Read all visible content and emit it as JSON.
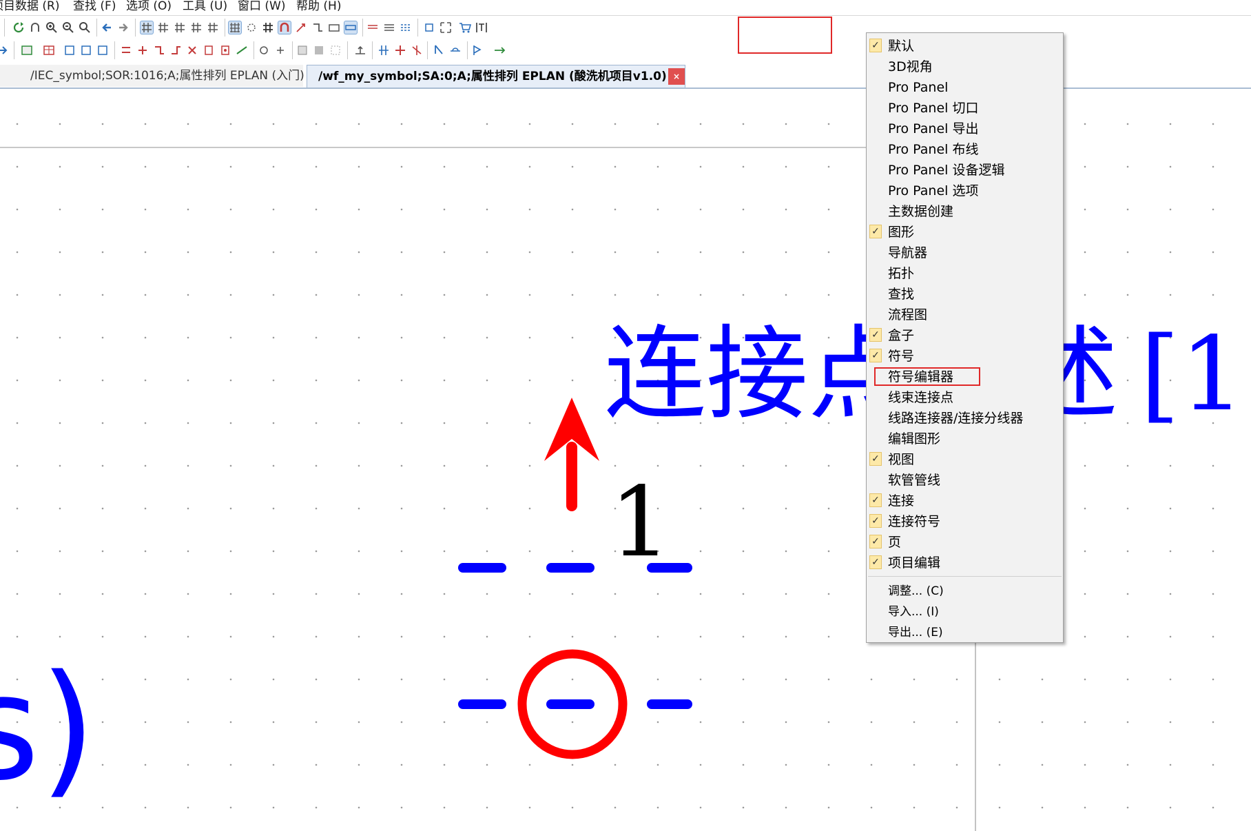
{
  "menubar": {
    "items": [
      "项目数据 (R)",
      "查找 (F)",
      "选项 (O)",
      "工具 (U)",
      "窗口 (W)",
      "帮助 (H)"
    ]
  },
  "toolbar": {
    "accent_color": "#2a6ebb"
  },
  "tabs": [
    {
      "label": "/IEC_symbol;SOR:1016;A;属性排列 EPLAN (入门)",
      "active": false
    },
    {
      "label": "/wf_my_symbol;SA:0;A;属性排列 EPLAN (酸洗机项目v1.0)",
      "active": true
    }
  ],
  "tab_close_glyph": "×",
  "canvas": {
    "big_text": "连接点",
    "big_text_fragment_1": "述",
    "big_text_fragment_2": "[1",
    "connection_number": "1",
    "corner_text": "s)",
    "colors": {
      "blue": "#0000ff",
      "red": "#ff0000",
      "black": "#000000"
    }
  },
  "context_menu": {
    "items": [
      {
        "label": "默认",
        "checked": true
      },
      {
        "label": "3D视角",
        "checked": false
      },
      {
        "label": "Pro Panel",
        "checked": false
      },
      {
        "label": "Pro Panel 切口",
        "checked": false
      },
      {
        "label": "Pro Panel 导出",
        "checked": false
      },
      {
        "label": "Pro Panel 布线",
        "checked": false
      },
      {
        "label": "Pro Panel 设备逻辑",
        "checked": false
      },
      {
        "label": "Pro Panel 选项",
        "checked": false
      },
      {
        "label": "主数据创建",
        "checked": false
      },
      {
        "label": "图形",
        "checked": true
      },
      {
        "label": "导航器",
        "checked": false
      },
      {
        "label": "拓扑",
        "checked": false
      },
      {
        "label": "查找",
        "checked": false
      },
      {
        "label": "流程图",
        "checked": false
      },
      {
        "label": "盒子",
        "checked": true
      },
      {
        "label": "符号",
        "checked": true
      },
      {
        "label": "符号编辑器",
        "checked": false,
        "highlighted": true
      },
      {
        "label": "线束连接点",
        "checked": false
      },
      {
        "label": "线路连接器/连接分线器",
        "checked": false
      },
      {
        "label": "编辑图形",
        "checked": false
      },
      {
        "label": "视图",
        "checked": true
      },
      {
        "label": "软管管线",
        "checked": false
      },
      {
        "label": "连接",
        "checked": true
      },
      {
        "label": "连接符号",
        "checked": true
      },
      {
        "label": "页",
        "checked": true
      },
      {
        "label": "项目编辑",
        "checked": true
      }
    ],
    "commands": [
      {
        "label": "调整... (C)"
      },
      {
        "label": "导入... (I)"
      },
      {
        "label": "导出... (E)"
      }
    ],
    "check_glyph": "✓",
    "highlight_color": "#e02828"
  }
}
